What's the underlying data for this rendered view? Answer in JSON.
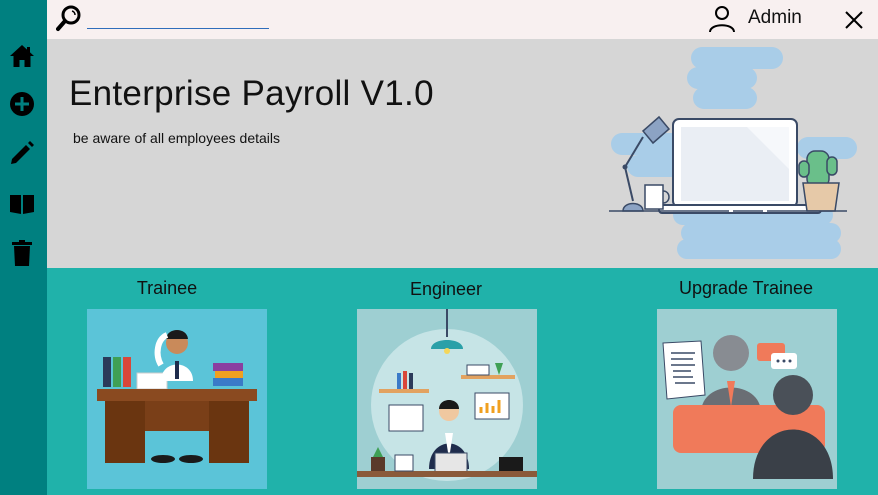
{
  "header": {
    "search": {
      "value": "",
      "placeholder": ""
    },
    "user_label": "Admin"
  },
  "sidebar": {
    "items": [
      {
        "icon": "home-icon"
      },
      {
        "icon": "add-circle-icon"
      },
      {
        "icon": "pencil-icon"
      },
      {
        "icon": "book-icon"
      },
      {
        "icon": "trash-icon"
      }
    ]
  },
  "hero": {
    "title": "Enterprise Payroll V1.0",
    "subtitle": "be aware of all employees details"
  },
  "cards": [
    {
      "title": "Trainee"
    },
    {
      "title": "Engineer"
    },
    {
      "title": "Upgrade Trainee"
    }
  ],
  "colors": {
    "sidebar": "#008080",
    "content": "#20b2aa",
    "hero": "#d6d6d6",
    "topbar": "#f8f0f0"
  }
}
